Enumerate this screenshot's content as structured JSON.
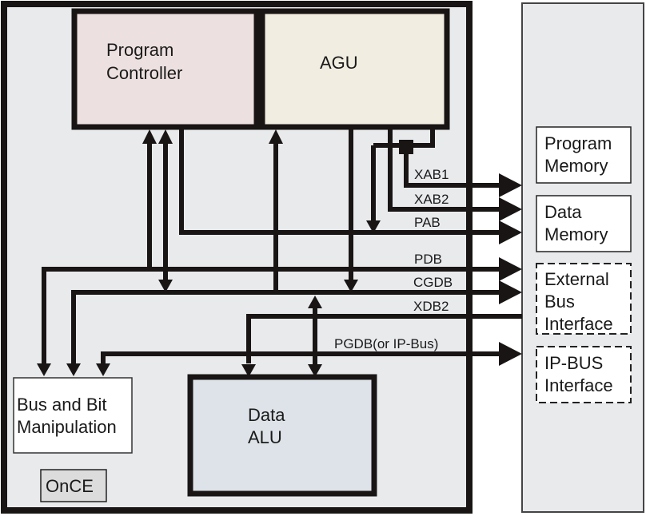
{
  "core": {
    "program_controller": {
      "line1": "Program",
      "line2": "Controller",
      "fill": "#ede0e0"
    },
    "agu": {
      "label": "AGU",
      "fill": "#f1ede0"
    },
    "data_alu": {
      "line1": "Data",
      "line2": "ALU",
      "fill": "#dde3e8"
    },
    "bus_bit": {
      "line1": "Bus and Bit",
      "line2": "Manipulation",
      "fill": "#ffffff"
    },
    "once": {
      "label": "OnCE",
      "fill": "#dcdcdc"
    },
    "fill": "#e8eaec"
  },
  "buses": {
    "xab1": "XAB1",
    "xab2": "XAB2",
    "pab": "PAB",
    "pdb": "PDB",
    "cgdb": "CGDB",
    "xdb2": "XDB2",
    "pgdb": "PGDB(or IP-Bus)"
  },
  "external": {
    "fill": "#e8eaec",
    "program_memory": {
      "line1": "Program",
      "line2": "Memory"
    },
    "data_memory": {
      "line1": "Data",
      "line2": "Memory"
    },
    "external_bus": {
      "line1": "External",
      "line2": "Bus",
      "line3": "Interface"
    },
    "ip_bus": {
      "line1": "IP-BUS",
      "line2": "Interface"
    }
  }
}
